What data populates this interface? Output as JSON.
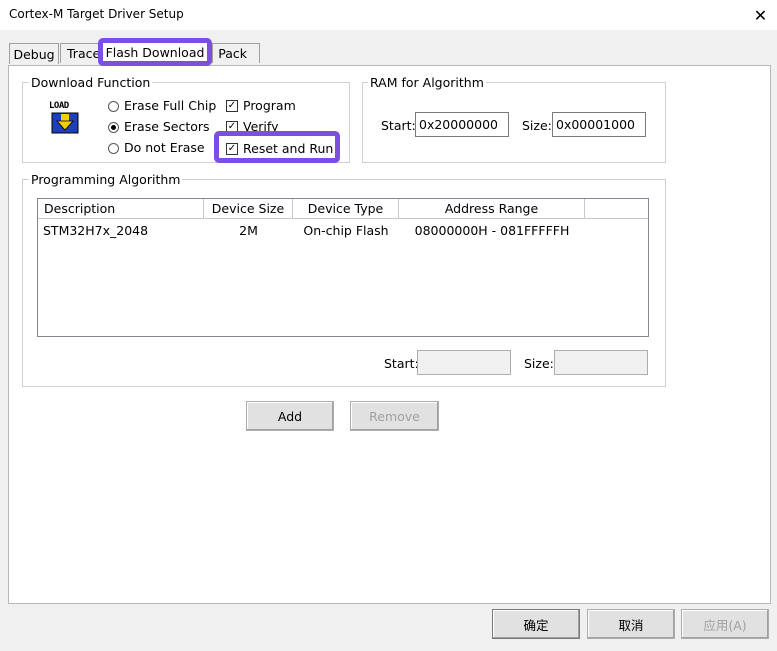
{
  "window": {
    "title": "Cortex-M Target Driver Setup",
    "close": "✕"
  },
  "tabs": [
    {
      "label": "Debug"
    },
    {
      "label": "Trace"
    },
    {
      "label": "Flash Download"
    },
    {
      "label": "Pack"
    }
  ],
  "download_function": {
    "legend": "Download Function",
    "load_icon_text": "LOAD",
    "erase_options": [
      {
        "label": "Erase Full Chip",
        "selected": false
      },
      {
        "label": "Erase Sectors",
        "selected": true
      },
      {
        "label": "Do not Erase",
        "selected": false
      }
    ],
    "checks": [
      {
        "label": "Program",
        "checked": true
      },
      {
        "label": "Verify",
        "checked": true
      },
      {
        "label": "Reset and Run",
        "checked": true
      }
    ]
  },
  "ram": {
    "legend": "RAM for Algorithm",
    "start_label": "Start:",
    "start_value": "0x20000000",
    "size_label": "Size:",
    "size_value": "0x00001000"
  },
  "programming": {
    "legend": "Programming Algorithm",
    "columns": [
      "Description",
      "Device Size",
      "Device Type",
      "Address Range"
    ],
    "rows": [
      {
        "description": "STM32H7x_2048",
        "size": "2M",
        "type": "On-chip Flash",
        "range": "08000000H - 081FFFFFH"
      }
    ],
    "start_label": "Start:",
    "start_value": "",
    "size_label": "Size:",
    "size_value": ""
  },
  "buttons": {
    "add": "Add",
    "remove": "Remove",
    "ok": "确定",
    "cancel": "取消",
    "apply": "应用(A)"
  },
  "colors": {
    "highlight": "#7b4fe0"
  }
}
